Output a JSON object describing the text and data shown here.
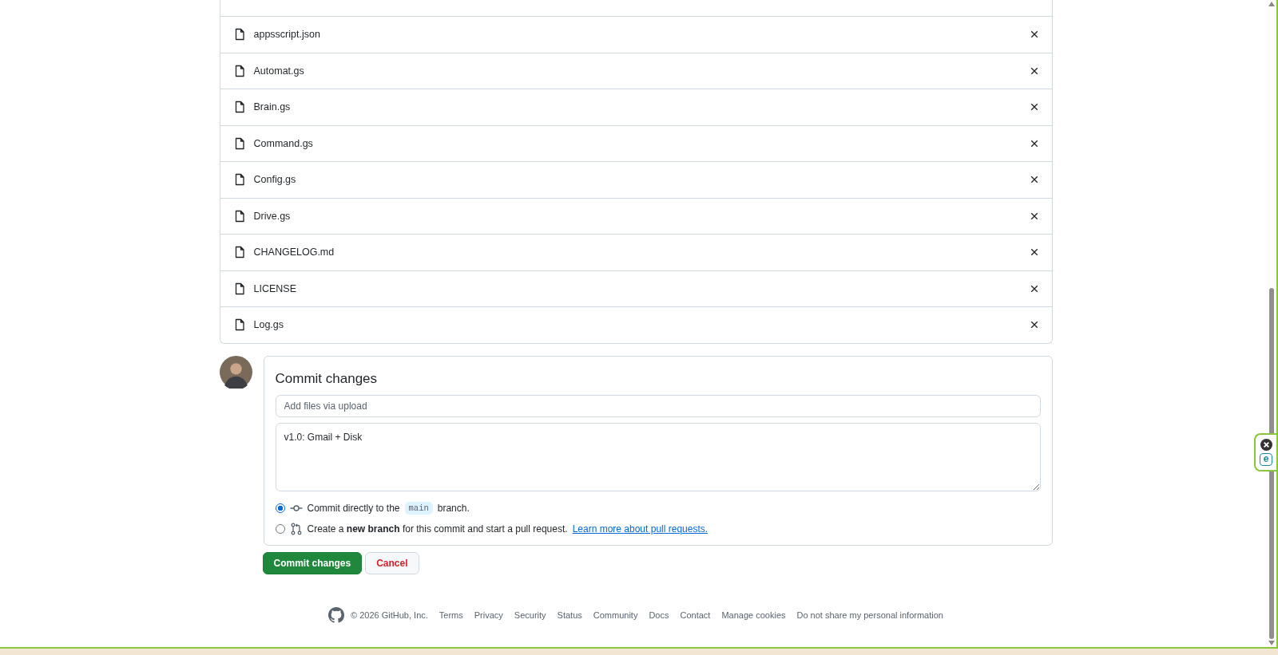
{
  "files": [
    {
      "name": "appsscript.json"
    },
    {
      "name": "Automat.gs"
    },
    {
      "name": "Brain.gs"
    },
    {
      "name": "Command.gs"
    },
    {
      "name": "Config.gs"
    },
    {
      "name": "Drive.gs"
    },
    {
      "name": "CHANGELOG.md"
    },
    {
      "name": "LICENSE"
    },
    {
      "name": "Log.gs"
    }
  ],
  "commit": {
    "title": "Commit changes",
    "filename_placeholder": "Add files via upload",
    "message": "v1.0: Gmail + Disk",
    "options": [
      {
        "kind": "direct",
        "selected": true,
        "text_before": "Commit directly to the",
        "branch": "main",
        "text_after": "branch."
      },
      {
        "kind": "new-branch",
        "selected": false,
        "text": "Create a **new branch** for this commit and start a pull request.",
        "link": "Learn more about pull requests."
      }
    ]
  },
  "buttons": [
    {
      "kind": "primary",
      "label": "Commit changes"
    },
    {
      "kind": "cancel",
      "label": "Cancel"
    }
  ],
  "footer": {
    "copyright": "© 2026 GitHub, Inc.",
    "links": [
      "Terms",
      "Privacy",
      "Security",
      "Status",
      "Community",
      "Docs",
      "Contact",
      "Manage cookies",
      "Do not share my personal information"
    ]
  },
  "extension_badge": {
    "logo_text": "e"
  }
}
